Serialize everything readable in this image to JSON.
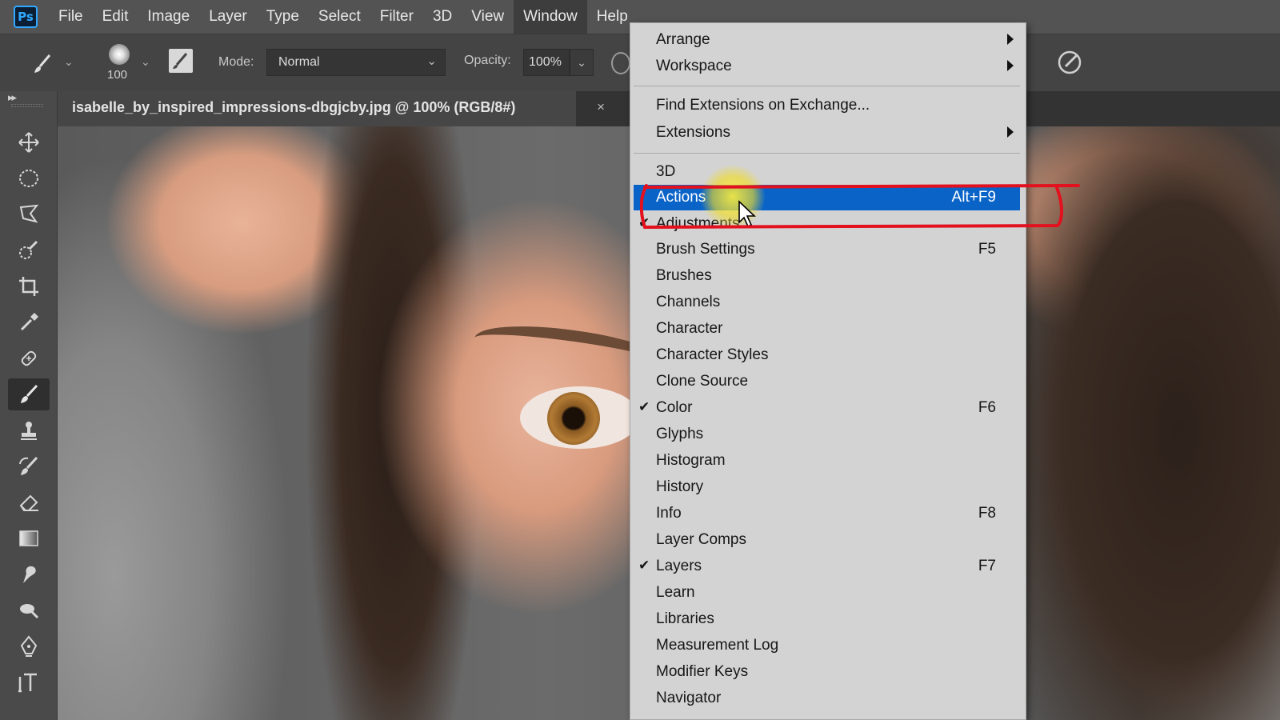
{
  "app": {
    "logo": "Ps"
  },
  "menubar": [
    {
      "label": "File"
    },
    {
      "label": "Edit"
    },
    {
      "label": "Image"
    },
    {
      "label": "Layer"
    },
    {
      "label": "Type"
    },
    {
      "label": "Select"
    },
    {
      "label": "Filter"
    },
    {
      "label": "3D"
    },
    {
      "label": "View"
    },
    {
      "label": "Window"
    },
    {
      "label": "Help"
    }
  ],
  "options": {
    "brush_size": "100",
    "mode_label": "Mode:",
    "mode_value": "Normal",
    "opacity_label": "Opacity:",
    "opacity_value": "100%"
  },
  "document_tab": {
    "title": "isabelle_by_inspired_impressions-dbgjcby.jpg @ 100% (RGB/8#)",
    "close": "×"
  },
  "tools": [
    "move-tool-icon",
    "ellipse-marquee-icon",
    "polygonal-lasso-icon",
    "quick-selection-icon",
    "crop-icon",
    "eyedropper-icon",
    "healing-brush-icon",
    "brush-icon",
    "clone-stamp-icon",
    "history-brush-icon",
    "eraser-icon",
    "gradient-icon",
    "smudge-icon",
    "dodge-icon",
    "pen-icon",
    "type-icon"
  ],
  "window_menu": {
    "highlight_color": "#0a64c8",
    "annotation_color": "#e3101e",
    "items": [
      {
        "label": "Arrange",
        "shortcut": "",
        "submenu": true,
        "checked": false
      },
      {
        "label": "Workspace",
        "shortcut": "",
        "submenu": true,
        "checked": false
      },
      {
        "label": "Find Extensions on Exchange...",
        "shortcut": "",
        "submenu": false,
        "checked": false
      },
      {
        "label": "Extensions",
        "shortcut": "",
        "submenu": true,
        "checked": false
      },
      {
        "label": "3D",
        "shortcut": "",
        "submenu": false,
        "checked": false
      },
      {
        "label": "Actions",
        "shortcut": "Alt+F9",
        "submenu": false,
        "checked": false,
        "highlighted": true
      },
      {
        "label": "Adjustments",
        "shortcut": "",
        "submenu": false,
        "checked": true
      },
      {
        "label": "Brush Settings",
        "shortcut": "F5",
        "submenu": false,
        "checked": false
      },
      {
        "label": "Brushes",
        "shortcut": "",
        "submenu": false,
        "checked": false
      },
      {
        "label": "Channels",
        "shortcut": "",
        "submenu": false,
        "checked": false
      },
      {
        "label": "Character",
        "shortcut": "",
        "submenu": false,
        "checked": false
      },
      {
        "label": "Character Styles",
        "shortcut": "",
        "submenu": false,
        "checked": false
      },
      {
        "label": "Clone Source",
        "shortcut": "",
        "submenu": false,
        "checked": false
      },
      {
        "label": "Color",
        "shortcut": "F6",
        "submenu": false,
        "checked": true
      },
      {
        "label": "Glyphs",
        "shortcut": "",
        "submenu": false,
        "checked": false
      },
      {
        "label": "Histogram",
        "shortcut": "",
        "submenu": false,
        "checked": false
      },
      {
        "label": "History",
        "shortcut": "",
        "submenu": false,
        "checked": false
      },
      {
        "label": "Info",
        "shortcut": "F8",
        "submenu": false,
        "checked": false
      },
      {
        "label": "Layer Comps",
        "shortcut": "",
        "submenu": false,
        "checked": false
      },
      {
        "label": "Layers",
        "shortcut": "F7",
        "submenu": false,
        "checked": true
      },
      {
        "label": "Learn",
        "shortcut": "",
        "submenu": false,
        "checked": false
      },
      {
        "label": "Libraries",
        "shortcut": "",
        "submenu": false,
        "checked": false
      },
      {
        "label": "Measurement Log",
        "shortcut": "",
        "submenu": false,
        "checked": false
      },
      {
        "label": "Modifier Keys",
        "shortcut": "",
        "submenu": false,
        "checked": false
      },
      {
        "label": "Navigator",
        "shortcut": "",
        "submenu": false,
        "checked": false
      }
    ]
  }
}
